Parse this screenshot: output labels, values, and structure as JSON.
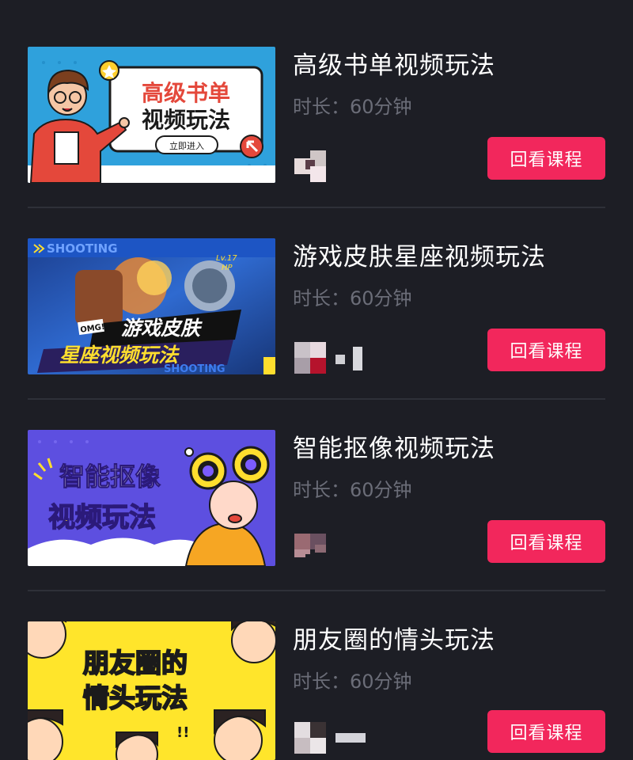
{
  "courses": [
    {
      "title": "高级书单视频玩法",
      "duration": "时长：60分钟",
      "button": "回看课程",
      "thumb_line1": "高级书单",
      "thumb_line2": "视频玩法",
      "thumb_sub": "立即进入"
    },
    {
      "title": "游戏皮肤星座视频玩法",
      "duration": "时长：60分钟",
      "button": "回看课程",
      "thumb_line1": "游戏皮肤",
      "thumb_line2": "星座视频玩法",
      "thumb_tag": "SHOOTING",
      "thumb_tag2": "SHOOTING",
      "thumb_omg": "OMG!",
      "thumb_lv": "Lv.17",
      "thumb_hp": "HP"
    },
    {
      "title": "智能抠像视频玩法",
      "duration": "时长：60分钟",
      "button": "回看课程",
      "thumb_line1": "智能抠像",
      "thumb_line2": "视频玩法"
    },
    {
      "title": "朋友圈的情头玩法",
      "duration": "时长：60分钟",
      "button": "回看课程",
      "thumb_line1": "朋友圈的",
      "thumb_line2": "情头玩法",
      "thumb_mark": "!!"
    }
  ],
  "colors": {
    "background": "#1d1e25",
    "button": "#f2275c",
    "duration_text": "#6b6d78"
  }
}
